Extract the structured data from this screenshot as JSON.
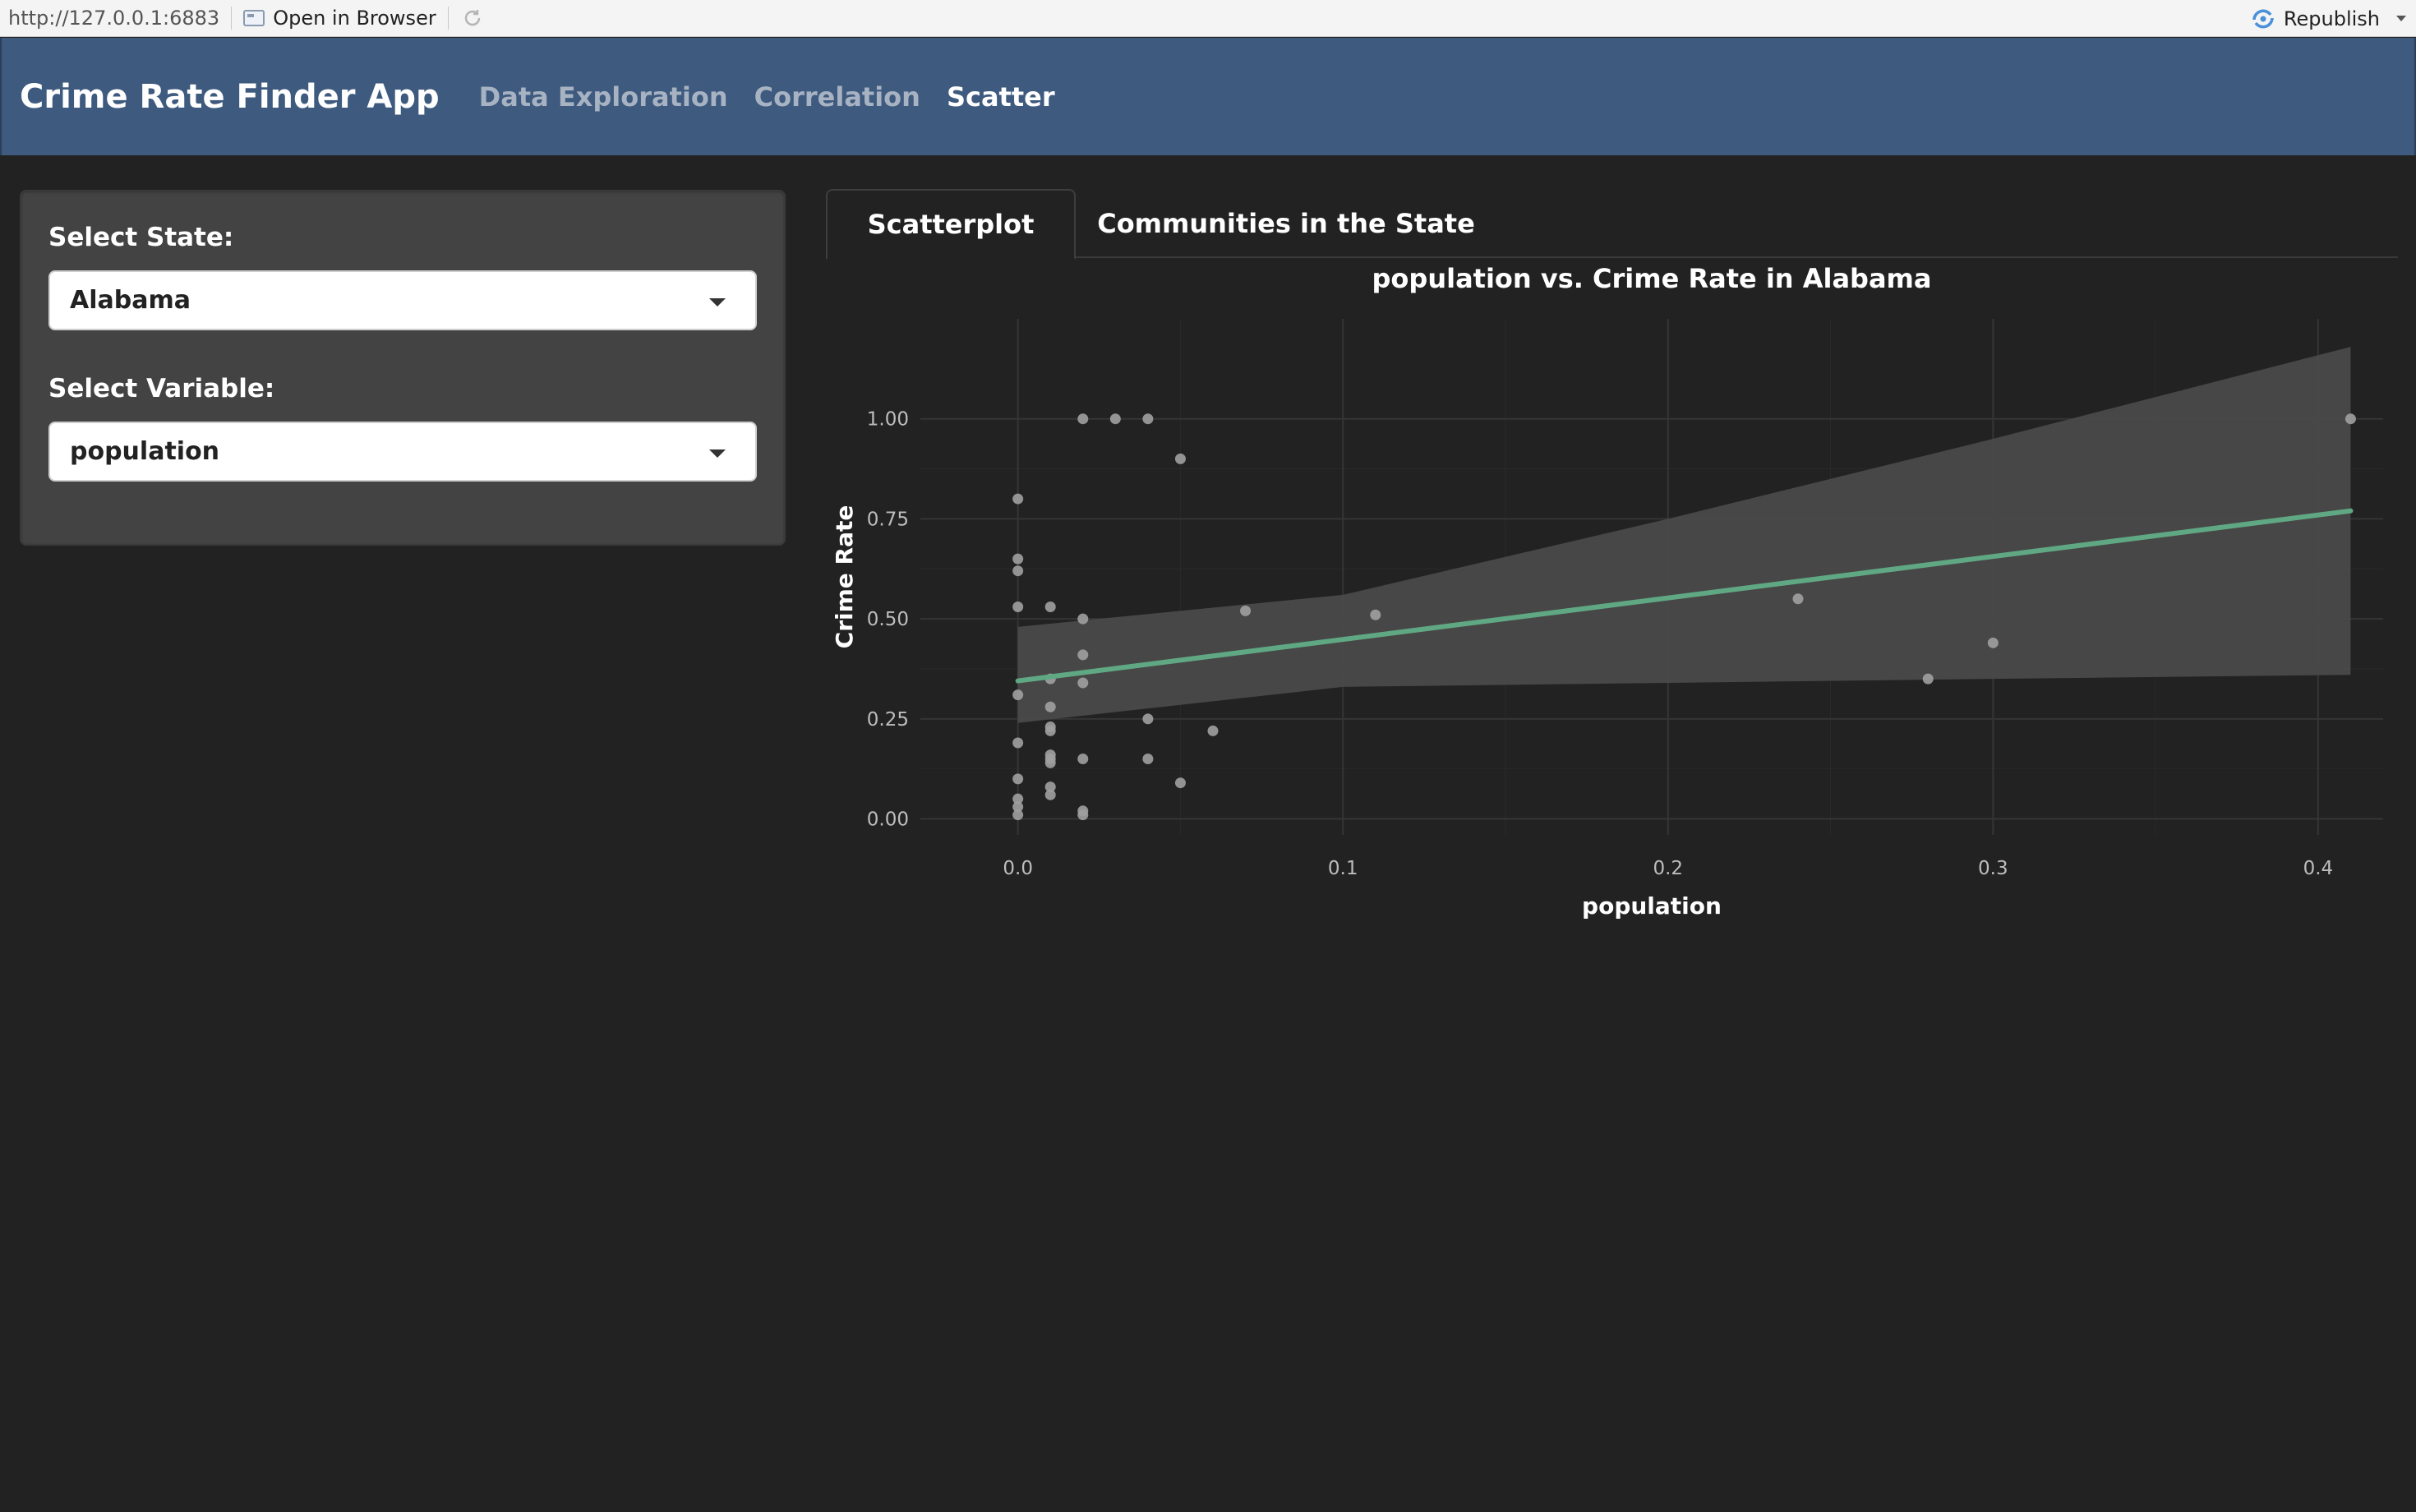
{
  "toolbar": {
    "url": "http://127.0.0.1:6883",
    "open_in_browser": "Open in Browser",
    "republish": "Republish"
  },
  "navbar": {
    "brand": "Crime Rate Finder App",
    "items": [
      "Data Exploration",
      "Correlation",
      "Scatter"
    ],
    "active": "Scatter"
  },
  "sidebar": {
    "state_label": "Select State:",
    "state_value": "Alabama",
    "variable_label": "Select Variable:",
    "variable_value": "population"
  },
  "tabs": [
    "Scatterplot",
    "Communities in the State"
  ],
  "colors": {
    "navbar": "#3e5a7e",
    "background": "#222222",
    "fit_line": "#5fa883",
    "ribbon": "#4a4a4a",
    "points": "#a0a0a0"
  },
  "chart_data": {
    "type": "scatter",
    "title": "population vs. Crime Rate in Alabama",
    "xlabel": "population",
    "ylabel": "Crime Rate",
    "xlim": [
      -0.03,
      0.42
    ],
    "ylim": [
      0.0,
      1.0
    ],
    "x_ticks": [
      "0.0",
      "0.1",
      "0.2",
      "0.3",
      "0.4"
    ],
    "x_tick_values": [
      0.0,
      0.1,
      0.2,
      0.3,
      0.4
    ],
    "y_ticks": [
      "0.00",
      "0.25",
      "0.50",
      "0.75",
      "1.00"
    ],
    "y_tick_values": [
      0.0,
      0.25,
      0.5,
      0.75,
      1.0
    ],
    "grid": true,
    "points": [
      {
        "x": 0.02,
        "y": 1.0
      },
      {
        "x": 0.03,
        "y": 1.0
      },
      {
        "x": 0.04,
        "y": 1.0
      },
      {
        "x": 0.05,
        "y": 0.9
      },
      {
        "x": 0.0,
        "y": 0.8
      },
      {
        "x": 0.0,
        "y": 0.65
      },
      {
        "x": 0.0,
        "y": 0.62
      },
      {
        "x": 0.0,
        "y": 0.53
      },
      {
        "x": 0.01,
        "y": 0.53
      },
      {
        "x": 0.02,
        "y": 0.5
      },
      {
        "x": 0.02,
        "y": 0.41
      },
      {
        "x": 0.01,
        "y": 0.35
      },
      {
        "x": 0.02,
        "y": 0.34
      },
      {
        "x": 0.0,
        "y": 0.31
      },
      {
        "x": 0.01,
        "y": 0.28
      },
      {
        "x": 0.04,
        "y": 0.25
      },
      {
        "x": 0.01,
        "y": 0.23
      },
      {
        "x": 0.01,
        "y": 0.22
      },
      {
        "x": 0.06,
        "y": 0.22
      },
      {
        "x": 0.0,
        "y": 0.19
      },
      {
        "x": 0.01,
        "y": 0.16
      },
      {
        "x": 0.01,
        "y": 0.15
      },
      {
        "x": 0.01,
        "y": 0.14
      },
      {
        "x": 0.02,
        "y": 0.15
      },
      {
        "x": 0.04,
        "y": 0.15
      },
      {
        "x": 0.0,
        "y": 0.1
      },
      {
        "x": 0.05,
        "y": 0.09
      },
      {
        "x": 0.01,
        "y": 0.08
      },
      {
        "x": 0.01,
        "y": 0.06
      },
      {
        "x": 0.0,
        "y": 0.05
      },
      {
        "x": 0.0,
        "y": 0.03
      },
      {
        "x": 0.0,
        "y": 0.01
      },
      {
        "x": 0.02,
        "y": 0.02
      },
      {
        "x": 0.02,
        "y": 0.01
      },
      {
        "x": 0.07,
        "y": 0.52
      },
      {
        "x": 0.11,
        "y": 0.51
      },
      {
        "x": 0.24,
        "y": 0.55
      },
      {
        "x": 0.28,
        "y": 0.35
      },
      {
        "x": 0.3,
        "y": 0.44
      },
      {
        "x": 0.41,
        "y": 1.0
      }
    ],
    "fit_line": {
      "x": [
        0.0,
        0.41
      ],
      "y": [
        0.345,
        0.77
      ]
    },
    "confidence_band": {
      "x": [
        0.0,
        0.1,
        0.2,
        0.3,
        0.41
      ],
      "upper": [
        0.48,
        0.56,
        0.75,
        0.95,
        1.18
      ],
      "lower": [
        0.24,
        0.33,
        0.34,
        0.35,
        0.36
      ]
    }
  }
}
